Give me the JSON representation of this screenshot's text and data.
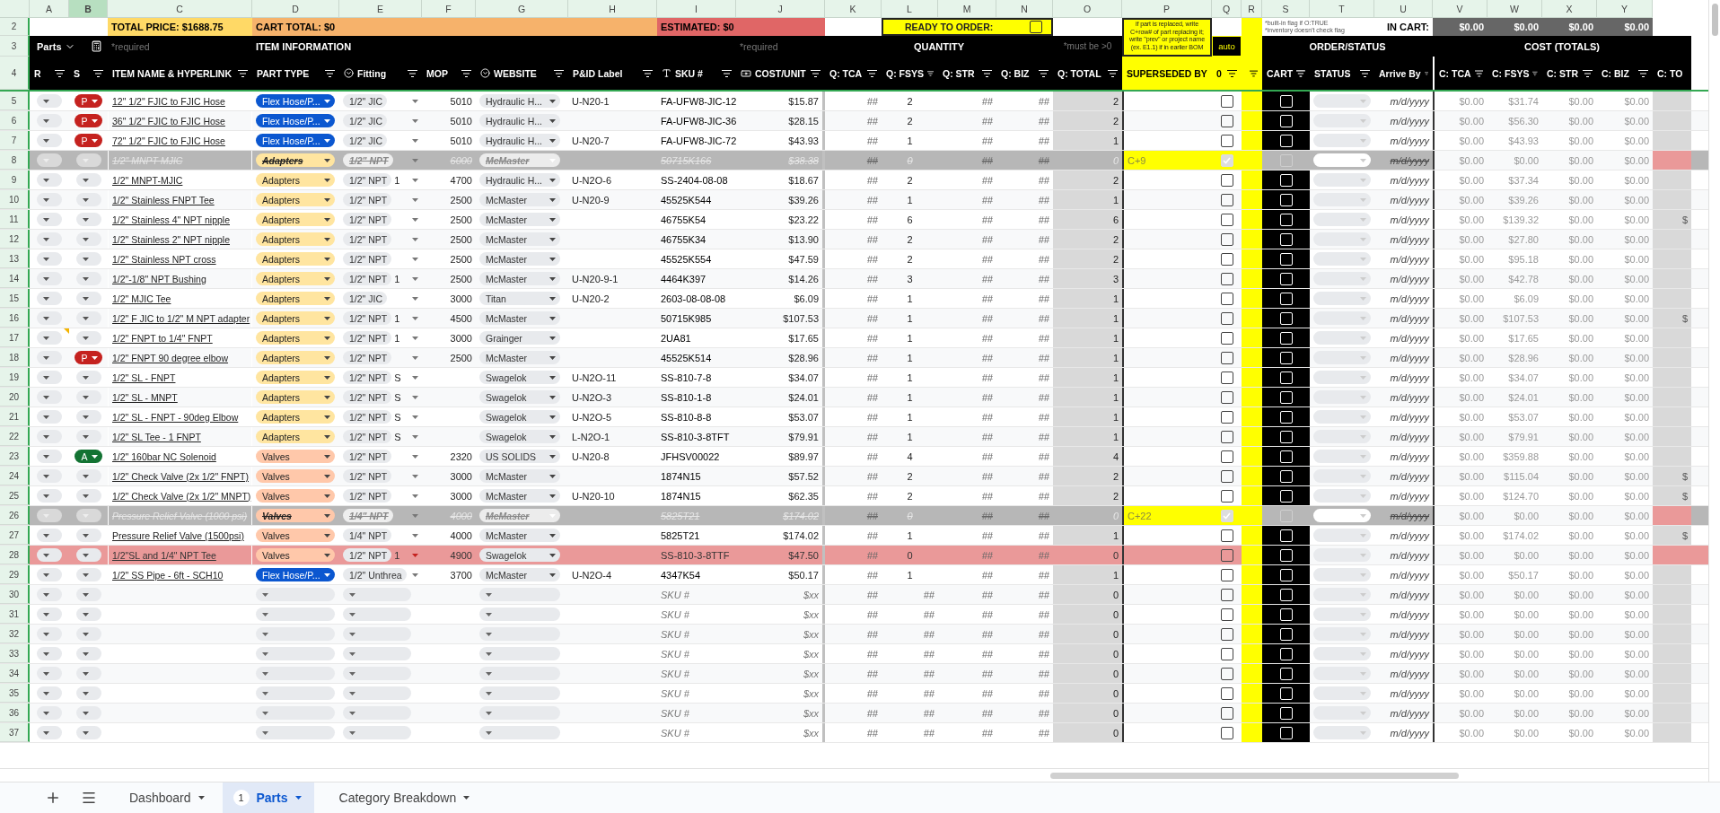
{
  "column_letters": [
    {
      "label": "A",
      "selected": false
    },
    {
      "label": "B",
      "selected": true
    },
    {
      "label": "C",
      "selected": false
    },
    {
      "label": "D",
      "selected": false
    },
    {
      "label": "E",
      "selected": false
    },
    {
      "label": "F",
      "selected": false
    },
    {
      "label": "G",
      "selected": false
    },
    {
      "label": "H",
      "selected": false
    },
    {
      "label": "I",
      "selected": false
    },
    {
      "label": "J",
      "selected": false
    },
    {
      "label": "K",
      "selected": false
    },
    {
      "label": "L",
      "selected": false
    },
    {
      "label": "M",
      "selected": false
    },
    {
      "label": "N",
      "selected": false
    },
    {
      "label": "O",
      "selected": false
    },
    {
      "label": "P",
      "selected": false
    },
    {
      "label": "Q",
      "selected": false
    },
    {
      "label": "R",
      "selected": false
    },
    {
      "label": "S",
      "selected": false
    },
    {
      "label": "T",
      "selected": false
    },
    {
      "label": "U",
      "selected": false
    },
    {
      "label": "V",
      "selected": false
    },
    {
      "label": "W",
      "selected": false
    },
    {
      "label": "X",
      "selected": false
    },
    {
      "label": "Y",
      "selected": false
    }
  ],
  "summary": {
    "row_numbers": [
      "2",
      "3",
      "4"
    ],
    "total_price": "TOTAL PRICE: $1688.75",
    "cart_total": "CART TOTAL: $0",
    "estimated": "ESTIMATED: $0",
    "ready_label": "READY TO ORDER:",
    "ready_checked": false,
    "note": "if part is replaced, write C+row# of part replacing it; write \"prev\" or project name (ex. E1.1) if in earlier BOM",
    "flag_notes": [
      "*built-in flag if O:TRUE",
      "*inventory doesn't check flag"
    ],
    "in_cart_label": "IN CART:",
    "in_cart_values": [
      "$0.00",
      "$0.00",
      "$0.00",
      "$0.00"
    ]
  },
  "sections": {
    "sheet_menu": "Parts",
    "required_left": "*required",
    "item_information": "ITEM INFORMATION",
    "required_right": "*required",
    "quantity": "QUANTITY",
    "quantity_hint": "*must be >0",
    "auto": "auto",
    "order_status": "ORDER/STATUS",
    "cost_totals": "COST (TOTALS)"
  },
  "headers": [
    {
      "label": "R",
      "kind": "plain"
    },
    {
      "label": "S",
      "kind": "plain"
    },
    {
      "label": "ITEM NAME & HYPERLINK",
      "kind": "plain"
    },
    {
      "label": "PART TYPE",
      "kind": "plain"
    },
    {
      "label": "Fitting",
      "kind": "dropdown"
    },
    {
      "label": "MOP",
      "kind": "plain"
    },
    {
      "label": "WEBSITE",
      "kind": "dropdown"
    },
    {
      "label": "P&ID Label",
      "kind": "plain"
    },
    {
      "label": "SKU #",
      "kind": "text"
    },
    {
      "label": "COST/UNIT",
      "kind": "currency"
    },
    {
      "label": "Q: TCA",
      "kind": "plain"
    },
    {
      "label": "Q: FSYS",
      "kind": "plain"
    },
    {
      "label": "Q: STR",
      "kind": "plain"
    },
    {
      "label": "Q: BIZ",
      "kind": "plain"
    },
    {
      "label": "Q: TOTAL",
      "kind": "plain"
    },
    {
      "label": "SUPERSEDED BY",
      "kind": "flag"
    },
    {
      "label": "0",
      "kind": "flag"
    },
    {
      "kind": "flag"
    },
    {
      "label": "CART",
      "kind": "plain"
    },
    {
      "label": "STATUS",
      "kind": "plain"
    },
    {
      "label": "Arrive By",
      "kind": "plain"
    },
    {
      "label": "C: TCA",
      "kind": "plain"
    },
    {
      "label": "C: FSYS",
      "kind": "plain"
    },
    {
      "label": "C: STR",
      "kind": "plain"
    },
    {
      "label": "C: BIZ",
      "kind": "plain"
    },
    {
      "label": "C: TO",
      "kind": "cut"
    }
  ],
  "rows": [
    {
      "num": "5",
      "kind": "normal",
      "status_badge": {
        "label": "P",
        "color": "#c5221f"
      },
      "name": "12\" 1/2\" FJIC to FJIC Hose",
      "part_type": {
        "label": "Flex Hose/P...",
        "color": "#0b57d0"
      },
      "fitting": "1/2\" JIC",
      "mop": "5010",
      "website": "Hydraulic H...",
      "pid": "U-N20-1",
      "sku": "FA-UFW8-JIC-12",
      "cost": "$15.87",
      "q": [
        "##",
        "2",
        "##",
        "##"
      ],
      "q_total": "2",
      "auto": false,
      "cart": false,
      "arrive": "m/d/yyyy",
      "costs": [
        "$0.00",
        "$31.74",
        "$0.00",
        "$0.00"
      ]
    },
    {
      "num": "6",
      "kind": "normal",
      "status_badge": {
        "label": "P",
        "color": "#c5221f"
      },
      "name": "36\" 1/2\" FJIC to FJIC Hose",
      "part_type": {
        "label": "Flex Hose/P...",
        "color": "#0b57d0"
      },
      "fitting": "1/2\" JIC",
      "mop": "5010",
      "website": "Hydraulic H...",
      "sku": "FA-UFW8-JIC-36",
      "cost": "$28.15",
      "q": [
        "##",
        "2",
        "##",
        "##"
      ],
      "q_total": "2",
      "auto": false,
      "cart": false,
      "arrive": "m/d/yyyy",
      "costs": [
        "$0.00",
        "$56.30",
        "$0.00",
        "$0.00"
      ]
    },
    {
      "num": "7",
      "kind": "normal",
      "status_badge": {
        "label": "P",
        "color": "#c5221f"
      },
      "name": "72\" 1/2\" FJIC to FJIC Hose",
      "part_type": {
        "label": "Flex Hose/P...",
        "color": "#0b57d0"
      },
      "fitting": "1/2\" JIC",
      "mop": "5010",
      "website": "Hydraulic H...",
      "pid": "U-N20-7",
      "sku": "FA-UFW8-JIC-72",
      "cost": "$43.93",
      "q": [
        "##",
        "1",
        "##",
        "##"
      ],
      "q_total": "1",
      "auto": false,
      "cart": false,
      "arrive": "m/d/yyyy",
      "costs": [
        "$0.00",
        "$43.93",
        "$0.00",
        "$0.00"
      ]
    },
    {
      "num": "8",
      "kind": "struck",
      "name": "1/2\" MNPT MJIC",
      "part_type": {
        "label": "Adapters",
        "color": "#ffe5a0"
      },
      "fitting": "1/2\" NPT",
      "mop": "6000",
      "website": "McMaster",
      "sku": "50715K166",
      "cost": "$38.38",
      "q": [
        "##",
        "0",
        "##",
        "##"
      ],
      "q_total": "0",
      "superseded": "C+9",
      "auto": true,
      "cart": false,
      "arrive": "m/d/yyyy",
      "costs": [
        "$0.00",
        "$0.00",
        "$0.00",
        "$0.00"
      ]
    },
    {
      "num": "9",
      "kind": "normal",
      "name": "1/2\" MNPT-MJIC",
      "part_type": {
        "label": "Adapters",
        "color": "#ffe5a0"
      },
      "fitting": "1/2\" NPT",
      "fitting_extra": "1",
      "mop": "4700",
      "website": "Hydraulic H...",
      "pid": "U-N2O-6",
      "sku": "SS-2404-08-08",
      "cost": "$18.67",
      "q": [
        "##",
        "2",
        "##",
        "##"
      ],
      "q_total": "2",
      "auto": false,
      "cart": false,
      "arrive": "m/d/yyyy",
      "costs": [
        "$0.00",
        "$37.34",
        "$0.00",
        "$0.00"
      ]
    },
    {
      "num": "10",
      "kind": "normal",
      "name": "1/2\" Stainless FNPT Tee",
      "part_type": {
        "label": "Adapters",
        "color": "#ffe5a0"
      },
      "fitting": "1/2\" NPT",
      "mop": "2500",
      "website": "McMaster",
      "pid": "U-N20-9",
      "sku": "45525K544",
      "cost": "$39.26",
      "q": [
        "##",
        "1",
        "##",
        "##"
      ],
      "q_total": "1",
      "auto": false,
      "cart": false,
      "arrive": "m/d/yyyy",
      "costs": [
        "$0.00",
        "$39.26",
        "$0.00",
        "$0.00"
      ]
    },
    {
      "num": "11",
      "kind": "normal",
      "name": "1/2\" Stainless 4\" NPT nipple",
      "part_type": {
        "label": "Adapters",
        "color": "#ffe5a0"
      },
      "fitting": "1/2\" NPT",
      "mop": "2500",
      "website": "McMaster",
      "sku": "46755K54",
      "cost": "$23.22",
      "q": [
        "##",
        "6",
        "##",
        "##"
      ],
      "q_total": "6",
      "auto": false,
      "cart": false,
      "arrive": "m/d/yyyy",
      "costs": [
        "$0.00",
        "$139.32",
        "$0.00",
        "$0.00"
      ],
      "total_cost": "$"
    },
    {
      "num": "12",
      "kind": "normal",
      "name": "1/2\" Stainless 2\" NPT nipple",
      "part_type": {
        "label": "Adapters",
        "color": "#ffe5a0"
      },
      "fitting": "1/2\" NPT",
      "mop": "2500",
      "website": "McMaster",
      "sku": "46755K34",
      "cost": "$13.90",
      "q": [
        "##",
        "2",
        "##",
        "##"
      ],
      "q_total": "2",
      "auto": false,
      "cart": false,
      "arrive": "m/d/yyyy",
      "costs": [
        "$0.00",
        "$27.80",
        "$0.00",
        "$0.00"
      ]
    },
    {
      "num": "13",
      "kind": "normal",
      "name": "1/2\" Stainless NPT cross",
      "part_type": {
        "label": "Adapters",
        "color": "#ffe5a0"
      },
      "fitting": "1/2\" NPT",
      "mop": "2500",
      "website": "McMaster",
      "sku": "45525K554",
      "cost": "$47.59",
      "q": [
        "##",
        "2",
        "##",
        "##"
      ],
      "q_total": "2",
      "auto": false,
      "cart": false,
      "arrive": "m/d/yyyy",
      "costs": [
        "$0.00",
        "$95.18",
        "$0.00",
        "$0.00"
      ]
    },
    {
      "num": "14",
      "kind": "normal",
      "name": "1/2\"-1/8\" NPT Bushing",
      "part_type": {
        "label": "Adapters",
        "color": "#ffe5a0"
      },
      "fitting": "1/2\" NPT",
      "fitting_extra": "1",
      "mop": "2500",
      "website": "McMaster",
      "pid": "U-N20-9-1",
      "sku": "4464K397",
      "cost": "$14.26",
      "q": [
        "##",
        "3",
        "##",
        "##"
      ],
      "q_total": "3",
      "auto": false,
      "cart": false,
      "arrive": "m/d/yyyy",
      "costs": [
        "$0.00",
        "$42.78",
        "$0.00",
        "$0.00"
      ]
    },
    {
      "num": "15",
      "kind": "normal",
      "name": "1/2\" MJIC Tee",
      "part_type": {
        "label": "Adapters",
        "color": "#ffe5a0"
      },
      "fitting": "1/2\" JIC",
      "mop": "3000",
      "website": "Titan",
      "pid": "U-N20-2",
      "sku": "2603-08-08-08",
      "cost": "$6.09",
      "q": [
        "##",
        "1",
        "##",
        "##"
      ],
      "q_total": "1",
      "auto": false,
      "cart": false,
      "arrive": "m/d/yyyy",
      "costs": [
        "$0.00",
        "$6.09",
        "$0.00",
        "$0.00"
      ]
    },
    {
      "num": "16",
      "kind": "normal",
      "name": "1/2\" F JIC to 1/2\" M NPT adapter",
      "part_type": {
        "label": "Adapters",
        "color": "#ffe5a0"
      },
      "fitting": "1/2\" NPT",
      "fitting_extra": "1",
      "mop": "4500",
      "website": "McMaster",
      "sku": "50715K985",
      "cost": "$107.53",
      "q": [
        "##",
        "1",
        "##",
        "##"
      ],
      "q_total": "1",
      "auto": false,
      "cart": false,
      "arrive": "m/d/yyyy",
      "costs": [
        "$0.00",
        "$107.53",
        "$0.00",
        "$0.00"
      ],
      "total_cost": "$"
    },
    {
      "num": "17",
      "kind": "normal",
      "comment": true,
      "name": "1/2\" FNPT to 1/4\" FNPT",
      "part_type": {
        "label": "Adapters",
        "color": "#ffe5a0"
      },
      "fitting": "1/2\" NPT",
      "fitting_extra": "1",
      "mop": "3000",
      "website": "Grainger",
      "sku": "2UA81",
      "cost": "$17.65",
      "q": [
        "##",
        "1",
        "##",
        "##"
      ],
      "q_total": "1",
      "auto": false,
      "cart": false,
      "arrive": "m/d/yyyy",
      "costs": [
        "$0.00",
        "$17.65",
        "$0.00",
        "$0.00"
      ]
    },
    {
      "num": "18",
      "kind": "normal",
      "status_badge": {
        "label": "P",
        "color": "#c5221f"
      },
      "name": "1/2\" FNPT 90 degree elbow",
      "part_type": {
        "label": "Adapters",
        "color": "#ffe5a0"
      },
      "fitting": "1/2\" NPT",
      "mop": "2500",
      "website": "McMaster",
      "sku": "45525K514",
      "cost": "$28.96",
      "q": [
        "##",
        "1",
        "##",
        "##"
      ],
      "q_total": "1",
      "auto": false,
      "cart": false,
      "arrive": "m/d/yyyy",
      "costs": [
        "$0.00",
        "$28.96",
        "$0.00",
        "$0.00"
      ]
    },
    {
      "num": "19",
      "kind": "normal",
      "name": "1/2\" SL - FNPT",
      "part_type": {
        "label": "Adapters",
        "color": "#ffe5a0"
      },
      "fitting": "1/2\" NPT",
      "fitting_extra": "S",
      "website": "Swagelok",
      "pid": "U-N2O-11",
      "sku": "SS-810-7-8",
      "cost": "$34.07",
      "q": [
        "##",
        "1",
        "##",
        "##"
      ],
      "q_total": "1",
      "auto": false,
      "cart": false,
      "arrive": "m/d/yyyy",
      "costs": [
        "$0.00",
        "$34.07",
        "$0.00",
        "$0.00"
      ]
    },
    {
      "num": "20",
      "kind": "normal",
      "name": "1/2\" SL - MNPT",
      "part_type": {
        "label": "Adapters",
        "color": "#ffe5a0"
      },
      "fitting": "1/2\" NPT",
      "fitting_extra": "S",
      "website": "Swagelok",
      "pid": "U-N2O-3",
      "sku": "SS-810-1-8",
      "cost": "$24.01",
      "q": [
        "##",
        "1",
        "##",
        "##"
      ],
      "q_total": "1",
      "auto": false,
      "cart": false,
      "arrive": "m/d/yyyy",
      "costs": [
        "$0.00",
        "$24.01",
        "$0.00",
        "$0.00"
      ]
    },
    {
      "num": "21",
      "kind": "normal",
      "name": "1/2\" SL - FNPT - 90deg Elbow",
      "part_type": {
        "label": "Adapters",
        "color": "#ffe5a0"
      },
      "fitting": "1/2\" NPT",
      "fitting_extra": "S",
      "website": "Swagelok",
      "pid": "U-N2O-5",
      "sku": "SS-810-8-8",
      "cost": "$53.07",
      "q": [
        "##",
        "1",
        "##",
        "##"
      ],
      "q_total": "1",
      "auto": false,
      "cart": false,
      "arrive": "m/d/yyyy",
      "costs": [
        "$0.00",
        "$53.07",
        "$0.00",
        "$0.00"
      ]
    },
    {
      "num": "22",
      "kind": "normal",
      "name": "1/2\" SL Tee - 1 FNPT",
      "part_type": {
        "label": "Adapters",
        "color": "#ffe5a0"
      },
      "fitting": "1/2\" NPT",
      "fitting_extra": "S",
      "website": "Swagelok",
      "pid": "L-N2O-1",
      "sku": "SS-810-3-8TFT",
      "cost": "$79.91",
      "q": [
        "##",
        "1",
        "##",
        "##"
      ],
      "q_total": "1",
      "auto": false,
      "cart": false,
      "arrive": "m/d/yyyy",
      "costs": [
        "$0.00",
        "$79.91",
        "$0.00",
        "$0.00"
      ]
    },
    {
      "num": "23",
      "kind": "normal",
      "status_badge": {
        "label": "A",
        "color": "#137333"
      },
      "name": "1/2\" 160bar NC Solenoid",
      "part_type": {
        "label": "Valves",
        "color": "#ffc8aa"
      },
      "fitting": "1/2\" NPT",
      "mop": "2320",
      "website": "US SOLIDS",
      "pid": "U-N20-8",
      "sku": "JFHSV00022",
      "cost": "$89.97",
      "q": [
        "##",
        "4",
        "##",
        "##"
      ],
      "q_total": "4",
      "auto": false,
      "cart": false,
      "arrive": "m/d/yyyy",
      "costs": [
        "$0.00",
        "$359.88",
        "$0.00",
        "$0.00"
      ]
    },
    {
      "num": "24",
      "kind": "normal",
      "name": "1/2\" Check Valve (2x 1/2\" FNPT)",
      "part_type": {
        "label": "Valves",
        "color": "#ffc8aa"
      },
      "fitting": "1/2\" NPT",
      "mop": "3000",
      "website": "McMaster",
      "sku": "1874N15",
      "cost": "$57.52",
      "q": [
        "##",
        "2",
        "##",
        "##"
      ],
      "q_total": "2",
      "auto": false,
      "cart": false,
      "arrive": "m/d/yyyy",
      "costs": [
        "$0.00",
        "$115.04",
        "$0.00",
        "$0.00"
      ],
      "total_cost": "$"
    },
    {
      "num": "25",
      "kind": "normal",
      "name": "1/2\" Check Valve (2x 1/2\" MNPT)",
      "part_type": {
        "label": "Valves",
        "color": "#ffc8aa"
      },
      "fitting": "1/2\" NPT",
      "mop": "3000",
      "website": "McMaster",
      "pid": "U-N20-10",
      "sku": "1874N15",
      "cost": "$62.35",
      "q": [
        "##",
        "2",
        "##",
        "##"
      ],
      "q_total": "2",
      "auto": false,
      "cart": false,
      "arrive": "m/d/yyyy",
      "costs": [
        "$0.00",
        "$124.70",
        "$0.00",
        "$0.00"
      ],
      "total_cost": "$"
    },
    {
      "num": "26",
      "kind": "struck",
      "name": "Pressure Relief Valve (1000 psi)",
      "part_type": {
        "label": "Valves",
        "color": "#ffc8aa"
      },
      "fitting": "1/4\" NPT",
      "mop": "4000",
      "website": "McMaster",
      "sku": "5825T21",
      "cost": "$174.02",
      "q": [
        "##",
        "0",
        "##",
        "##"
      ],
      "q_total": "0",
      "superseded": "C+22",
      "auto": true,
      "cart": false,
      "arrive": "m/d/yyyy",
      "costs": [
        "$0.00",
        "$0.00",
        "$0.00",
        "$0.00"
      ]
    },
    {
      "num": "27",
      "kind": "normal",
      "name": "Pressure Relief Valve (1500psi)",
      "part_type": {
        "label": "Valves",
        "color": "#ffc8aa"
      },
      "fitting": "1/4\" NPT",
      "mop": "4000",
      "website": "McMaster",
      "sku": "5825T21",
      "cost": "$174.02",
      "q": [
        "##",
        "1",
        "##",
        "##"
      ],
      "q_total": "1",
      "auto": false,
      "cart": false,
      "arrive": "m/d/yyyy",
      "costs": [
        "$0.00",
        "$174.02",
        "$0.00",
        "$0.00"
      ],
      "total_cost": "$"
    },
    {
      "num": "28",
      "kind": "error",
      "name": "1/2\"SL and 1/4\" NPT Tee",
      "part_type": {
        "label": "Valves",
        "color": "#ffc8aa"
      },
      "fitting": "1/2\" NPT",
      "fitting_extra": "1",
      "mop": "4900",
      "website": "Swagelok",
      "sku": "SS-810-3-8TTF",
      "cost": "$47.50",
      "q": [
        "##",
        "0",
        "##",
        "##"
      ],
      "q_total": "0",
      "auto": false,
      "cart": false,
      "arrive": "m/d/yyyy",
      "costs": [
        "$0.00",
        "$0.00",
        "$0.00",
        "$0.00"
      ]
    },
    {
      "num": "29",
      "kind": "normal",
      "name": "1/2\" SS Pipe - 6ft - SCH10",
      "part_type": {
        "label": "Flex Hose/P...",
        "color": "#0b57d0"
      },
      "fitting": "1/2\" Unthrea",
      "mop": "3700",
      "website": "McMaster",
      "pid": "U-N2O-4",
      "sku": "4347K54",
      "cost": "$50.17",
      "q": [
        "##",
        "1",
        "##",
        "##"
      ],
      "q_total": "1",
      "auto": false,
      "cart": false,
      "arrive": "m/d/yyyy",
      "costs": [
        "$0.00",
        "$50.17",
        "$0.00",
        "$0.00"
      ]
    },
    {
      "num": "30",
      "kind": "blank",
      "sku": "SKU #",
      "cost": "$xx",
      "q": [
        "##",
        "##",
        "##",
        "##"
      ],
      "q_total": "0",
      "auto": false,
      "cart": false,
      "arrive": "m/d/yyyy",
      "costs": [
        "$0.00",
        "$0.00",
        "$0.00",
        "$0.00"
      ]
    },
    {
      "num": "31",
      "kind": "blank",
      "sku": "SKU #",
      "cost": "$xx",
      "q": [
        "##",
        "##",
        "##",
        "##"
      ],
      "q_total": "0",
      "auto": false,
      "cart": false,
      "arrive": "m/d/yyyy",
      "costs": [
        "$0.00",
        "$0.00",
        "$0.00",
        "$0.00"
      ]
    },
    {
      "num": "32",
      "kind": "blank",
      "sku": "SKU #",
      "cost": "$xx",
      "q": [
        "##",
        "##",
        "##",
        "##"
      ],
      "q_total": "0",
      "auto": false,
      "cart": false,
      "arrive": "m/d/yyyy",
      "costs": [
        "$0.00",
        "$0.00",
        "$0.00",
        "$0.00"
      ]
    },
    {
      "num": "33",
      "kind": "blank",
      "sku": "SKU #",
      "cost": "$xx",
      "q": [
        "##",
        "##",
        "##",
        "##"
      ],
      "q_total": "0",
      "auto": false,
      "cart": false,
      "arrive": "m/d/yyyy",
      "costs": [
        "$0.00",
        "$0.00",
        "$0.00",
        "$0.00"
      ]
    },
    {
      "num": "34",
      "kind": "blank",
      "sku": "SKU #",
      "cost": "$xx",
      "q": [
        "##",
        "##",
        "##",
        "##"
      ],
      "q_total": "0",
      "auto": false,
      "cart": false,
      "arrive": "m/d/yyyy",
      "costs": [
        "$0.00",
        "$0.00",
        "$0.00",
        "$0.00"
      ]
    },
    {
      "num": "35",
      "kind": "blank",
      "sku": "SKU #",
      "cost": "$xx",
      "q": [
        "##",
        "##",
        "##",
        "##"
      ],
      "q_total": "0",
      "auto": false,
      "cart": false,
      "arrive": "m/d/yyyy",
      "costs": [
        "$0.00",
        "$0.00",
        "$0.00",
        "$0.00"
      ]
    },
    {
      "num": "36",
      "kind": "blank",
      "sku": "SKU #",
      "cost": "$xx",
      "q": [
        "##",
        "##",
        "##",
        "##"
      ],
      "q_total": "0",
      "auto": false,
      "cart": false,
      "arrive": "m/d/yyyy",
      "costs": [
        "$0.00",
        "$0.00",
        "$0.00",
        "$0.00"
      ]
    },
    {
      "num": "37",
      "kind": "blank",
      "sku": "SKU #",
      "cost": "$xx",
      "q": [
        "##",
        "##",
        "##",
        "##"
      ],
      "q_total": "0",
      "auto": false,
      "cart": false,
      "arrive": "m/d/yyyy",
      "costs": [
        "$0.00",
        "$0.00",
        "$0.00",
        "$0.00"
      ]
    }
  ],
  "sheet_tabs": [
    {
      "label": "Dashboard",
      "selected": false
    },
    {
      "label": "Parts",
      "badge": "1",
      "selected": true
    },
    {
      "label": "Category Breakdown",
      "selected": false
    }
  ]
}
